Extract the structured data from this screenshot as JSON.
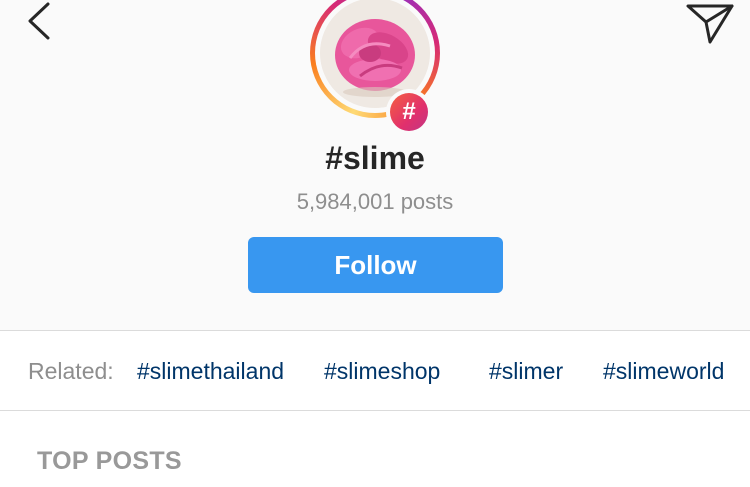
{
  "header": {
    "back_icon": "chevron-left-icon",
    "share_icon": "paper-plane-icon"
  },
  "profile": {
    "hashtag": "#slime",
    "post_count": "5,984,001 posts",
    "badge_symbol": "#",
    "follow_label": "Follow"
  },
  "related": {
    "label": "Related:",
    "tags": [
      "#slimethailand",
      "#slimeshop",
      "#slimer",
      "#slimeworld"
    ]
  },
  "section": {
    "title": "TOP POSTS"
  },
  "colors": {
    "follow_button": "#3897f0",
    "related_tag": "#003569",
    "muted_text": "#8e8e8e"
  }
}
